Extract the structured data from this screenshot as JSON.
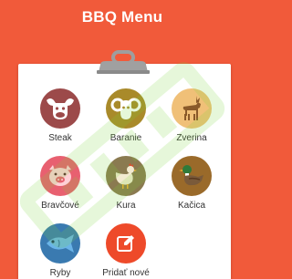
{
  "header": {
    "title": "BBQ Menu"
  },
  "categories": [
    {
      "label": "Steak",
      "icon": "cow-icon",
      "color": "#9c4a4a"
    },
    {
      "label": "Baranie",
      "icon": "ram-icon",
      "color": "#a98a2a"
    },
    {
      "label": "Zverina",
      "icon": "deer-icon",
      "color": "#e8a84a"
    },
    {
      "label": "Bravčové",
      "icon": "pig-icon",
      "color": "#e86070"
    },
    {
      "label": "Kura",
      "icon": "chicken-icon",
      "color": "#8a7a50"
    },
    {
      "label": "Kačica",
      "icon": "duck-icon",
      "color": "#9a6a2a"
    },
    {
      "label": "Ryby",
      "icon": "fish-icon",
      "color": "#3a7ab0"
    },
    {
      "label": "Pridať nové",
      "icon": "edit-icon",
      "color": "#ee4a2a"
    }
  ],
  "colors": {
    "background": "#f15a3a",
    "card": "#ffffff",
    "watermark": "#7cd63a"
  }
}
